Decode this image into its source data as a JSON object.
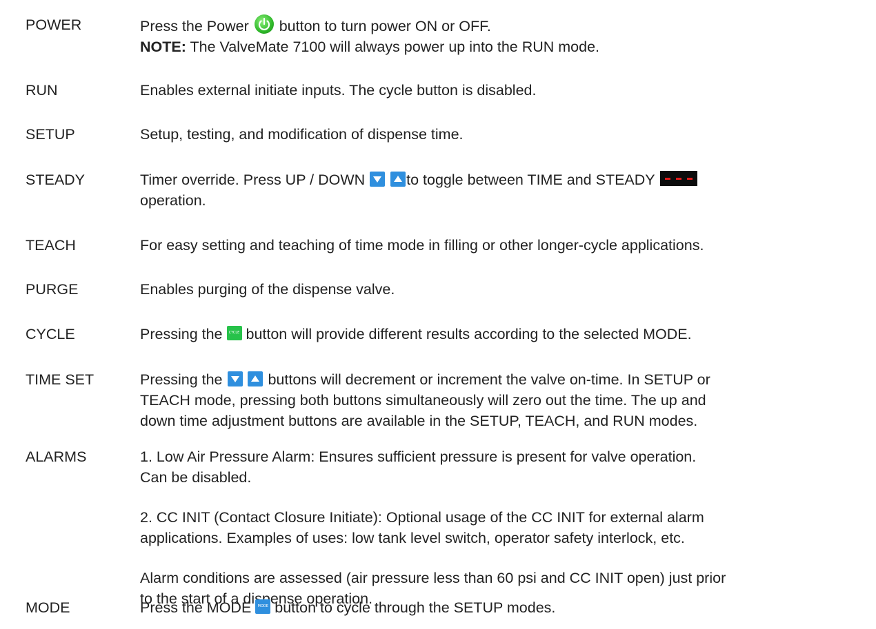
{
  "rows": [
    {
      "term": "POWER",
      "p1": "Press the Power",
      "p2": "button to turn power ON or OFF.",
      "note_label": "NOTE:",
      "note_text": "The ValveMate 7100 will always power up into the RUN mode."
    },
    {
      "term": "RUN",
      "text": "Enables external initiate inputs. The cycle button is disabled."
    },
    {
      "term": "SETUP",
      "text": "Setup, testing, and modification of dispense time."
    },
    {
      "term": "STEADY",
      "p1": "Timer override. Press UP / DOWN",
      "p2": "to toggle between TIME and STEADY",
      "p3": "operation."
    },
    {
      "term": "TEACH",
      "text": "For easy setting and teaching of time mode in filling or other longer-cycle applications."
    },
    {
      "term": "PURGE",
      "text": "Enables purging of the dispense valve."
    },
    {
      "term": "CYCLE",
      "p1": "Pressing the",
      "p2": "button will provide different results according to the selected MODE.",
      "icon_text": "CYCLE"
    },
    {
      "term": "TIME SET",
      "p1": "Pressing the",
      "p2": "buttons will decrement or increment the valve on-time. In SETUP or",
      "p3": "TEACH mode, pressing both buttons simultaneously will zero out the time. The up and",
      "p4": "down time adjustment buttons are available in the SETUP, TEACH, and RUN modes."
    },
    {
      "term": "ALARMS",
      "para1_line1": "1. Low Air Pressure Alarm: Ensures sufficient pressure is present for valve operation.",
      "para1_line2": "Can be disabled.",
      "para2_line1": "2. CC INIT (Contact Closure Initiate): Optional usage of the CC INIT for external alarm",
      "para2_line2": "applications. Examples of uses: low tank level switch, operator safety interlock, etc.",
      "para3_line1": "Alarm conditions are assessed (air pressure less than 60 psi and CC INIT open) just prior",
      "para3_line2": "to the start of a dispense operation."
    },
    {
      "term": "MODE",
      "p1": "Press the MODE",
      "p2": "button to cycle through the SETUP modes.",
      "icon_text": "MODE"
    }
  ],
  "icons": {
    "power_color": "#2fb82a",
    "arrow_color": "#2f8fde",
    "cycle_color": "#27c24a",
    "mode_color": "#2f8fde",
    "dash_color": "#e21b1b"
  }
}
